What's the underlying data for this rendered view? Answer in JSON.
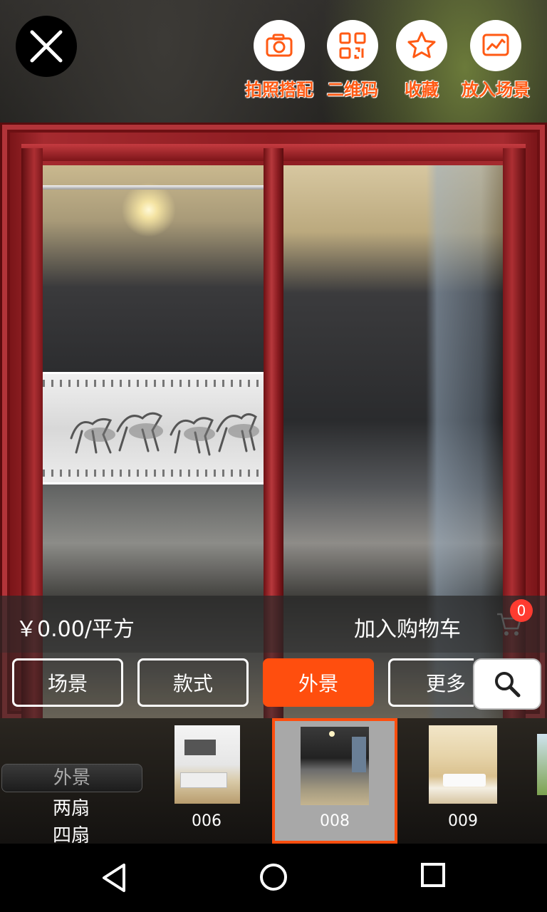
{
  "colors": {
    "accent": "#ff4e0e",
    "badge": "#ff3b30",
    "frame": "#a52a2f",
    "label": "#ff5a14"
  },
  "top_bar": {
    "close_icon": "close-icon",
    "actions": [
      {
        "label": "拍照搭配",
        "icon": "camera-icon"
      },
      {
        "label": "二维码",
        "icon": "qrcode-icon"
      },
      {
        "label": "收藏",
        "icon": "star-icon"
      },
      {
        "label": "放入场景",
        "icon": "image-icon"
      }
    ]
  },
  "price_bar": {
    "price": "￥0.00/平方",
    "add_to_cart": "加入购物车",
    "cart_count": "0"
  },
  "tabs": [
    {
      "label": "场景",
      "active": false
    },
    {
      "label": "款式",
      "active": false
    },
    {
      "label": "外景",
      "active": true
    },
    {
      "label": "更多",
      "active": false
    }
  ],
  "side_menu": {
    "selected": "外景",
    "items": [
      "两扇",
      "四扇"
    ]
  },
  "thumbnails": [
    {
      "caption": "006",
      "selected": false
    },
    {
      "caption": "008",
      "selected": true
    },
    {
      "caption": "009",
      "selected": false
    }
  ]
}
